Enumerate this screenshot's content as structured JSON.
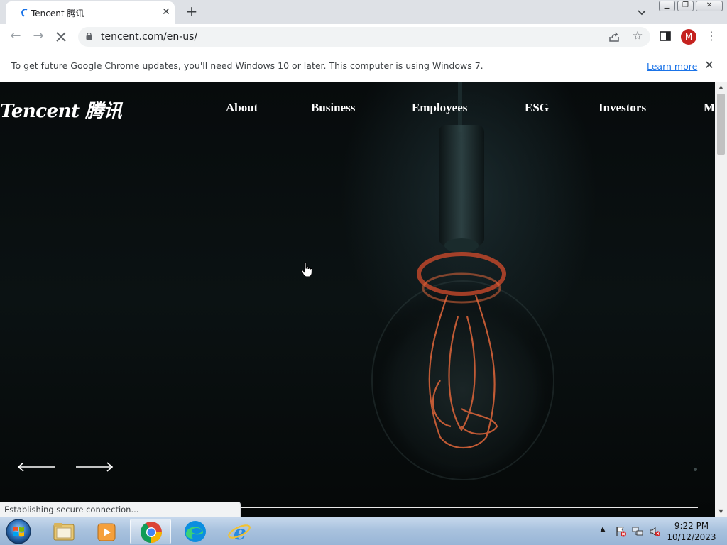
{
  "browser": {
    "tab": {
      "title": "Tencent 腾讯",
      "loading": true
    },
    "address": {
      "url": "tencent.com/en-us/"
    },
    "profile_initial": "M",
    "infobar": {
      "message": "To get future Google Chrome updates, you'll need Windows 10 or later. This computer is using Windows 7.",
      "link": "Learn more"
    },
    "status_bubble": "Establishing secure connection..."
  },
  "site": {
    "logo": "Tencent 腾讯",
    "nav": [
      "About",
      "Business",
      "Employees",
      "ESG",
      "Investors",
      "M"
    ]
  },
  "taskbar": {
    "apps": [
      "windows-explorer",
      "media-player",
      "google-chrome",
      "microsoft-edge",
      "internet-explorer"
    ],
    "active_app": "google-chrome",
    "clock": {
      "time": "9:22 PM",
      "date": "10/12/2023"
    }
  },
  "colors": {
    "chrome_tabstrip": "#dee1e6",
    "omnibox": "#f1f3f4",
    "link": "#1a73e8",
    "avatar": "#c5221f",
    "hero_bg": "#070b0c",
    "filament": "#e0663a"
  }
}
